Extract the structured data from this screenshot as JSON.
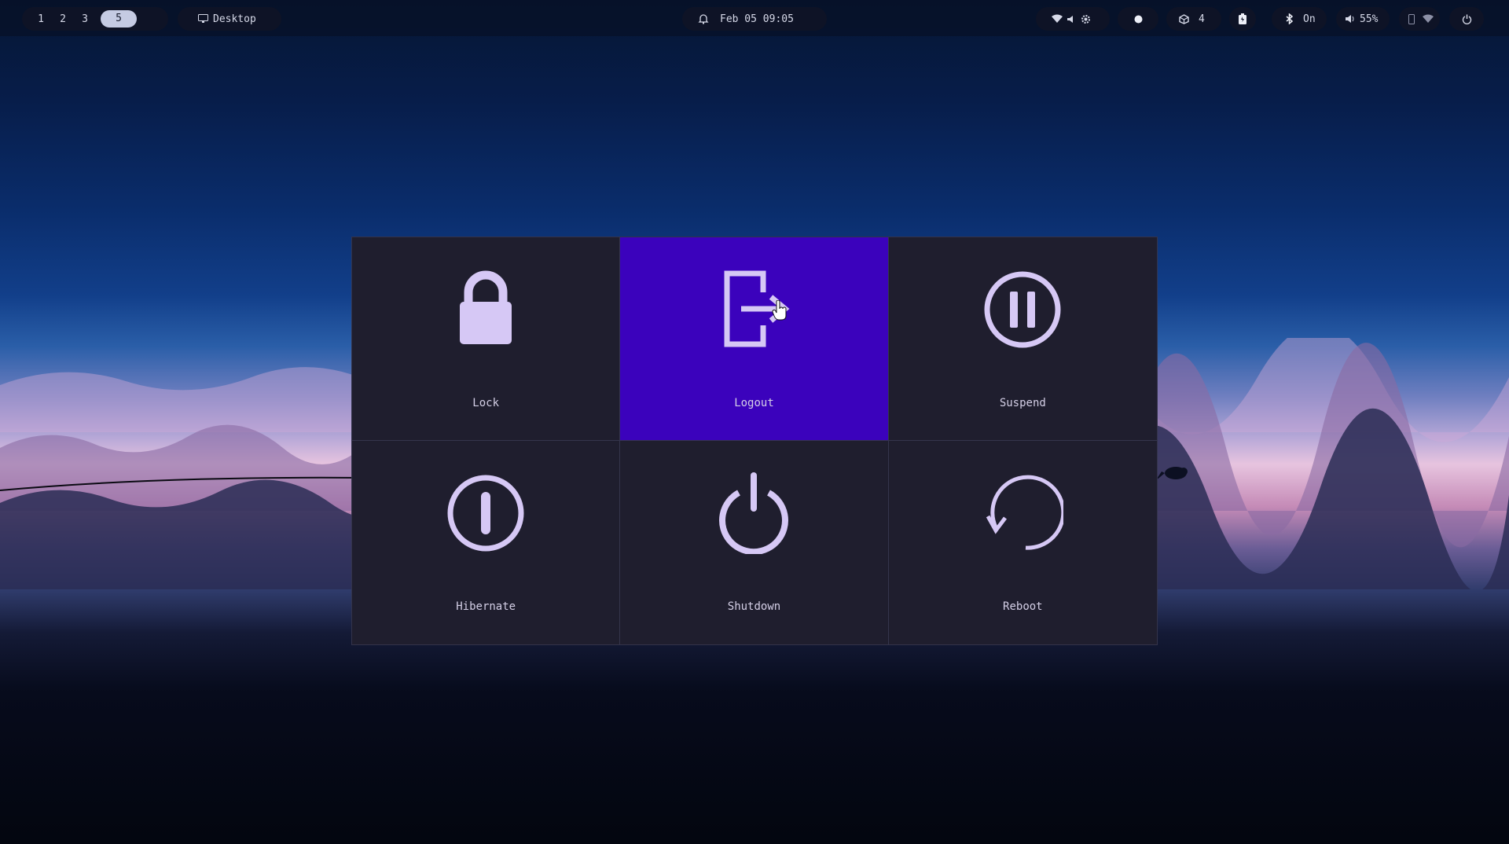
{
  "topbar": {
    "workspaces": [
      "1",
      "2",
      "3",
      "5"
    ],
    "active_workspace": "5",
    "window_title": "Desktop",
    "datetime": "Feb 05 09:05",
    "updates_count": "4",
    "bluetooth_status": "On",
    "volume": "55%"
  },
  "menu": {
    "items": [
      {
        "label": "Lock",
        "icon": "lock-icon"
      },
      {
        "label": "Logout",
        "icon": "logout-icon",
        "selected": true
      },
      {
        "label": "Suspend",
        "icon": "pause-icon"
      },
      {
        "label": "Hibernate",
        "icon": "hibernate-icon"
      },
      {
        "label": "Shutdown",
        "icon": "power-icon"
      },
      {
        "label": "Reboot",
        "icon": "reboot-icon"
      }
    ]
  },
  "colors": {
    "tile_bg": "#1f1e2e",
    "selected_bg": "#3b02bc",
    "icon": "#d6c8f5",
    "bar_text": "#d6d9e8"
  }
}
